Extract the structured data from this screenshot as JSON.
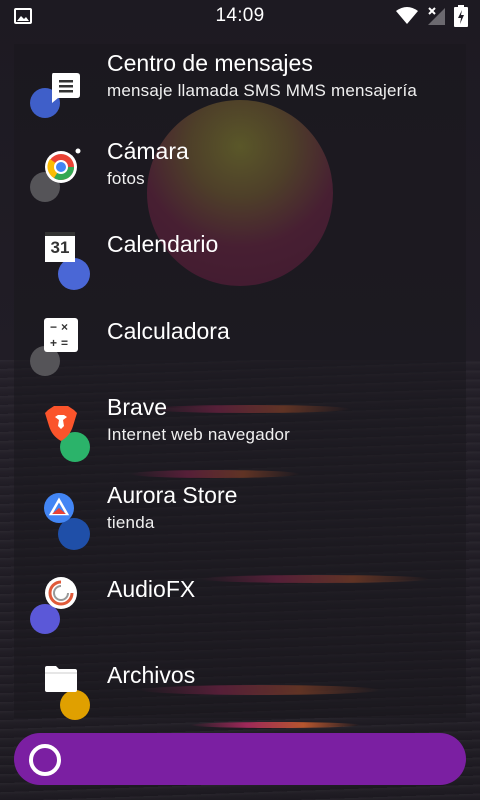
{
  "status_bar": {
    "time": "14:09",
    "icons": [
      "image-icon",
      "wifi-icon",
      "no-signal-icon",
      "battery-charging-icon"
    ]
  },
  "apps": [
    {
      "name": "Centro de mensajes",
      "subtitle": "mensaje llamada SMS MMS mensajería",
      "icon": "message-icon",
      "badge_color": "#3f5fc9"
    },
    {
      "name": "Cámara",
      "subtitle": "fotos",
      "icon": "camera-icon",
      "badge_color": "#555458"
    },
    {
      "name": "Calendario",
      "subtitle": "",
      "icon": "calendar-icon",
      "icon_text": "31",
      "badge_color": "#4a67d6"
    },
    {
      "name": "Calculadora",
      "subtitle": "",
      "icon": "calculator-icon",
      "icon_text": "−×+=",
      "badge_color": "#555458"
    },
    {
      "name": "Brave",
      "subtitle": "Internet  web  navegador",
      "icon": "brave-lion-icon",
      "badge_color": "#2bb36a"
    },
    {
      "name": "Aurora Store",
      "subtitle": "tienda",
      "icon": "aurora-store-icon",
      "badge_color": "#1f4fa8"
    },
    {
      "name": "AudioFX",
      "subtitle": "",
      "icon": "audiofx-icon",
      "badge_color": "#5b58d8"
    },
    {
      "name": "Archivos",
      "subtitle": "",
      "icon": "folder-icon",
      "badge_color": "#e0a000"
    }
  ],
  "colors": {
    "search_bar": "#7b1fa2",
    "background": "#1f1b24"
  }
}
